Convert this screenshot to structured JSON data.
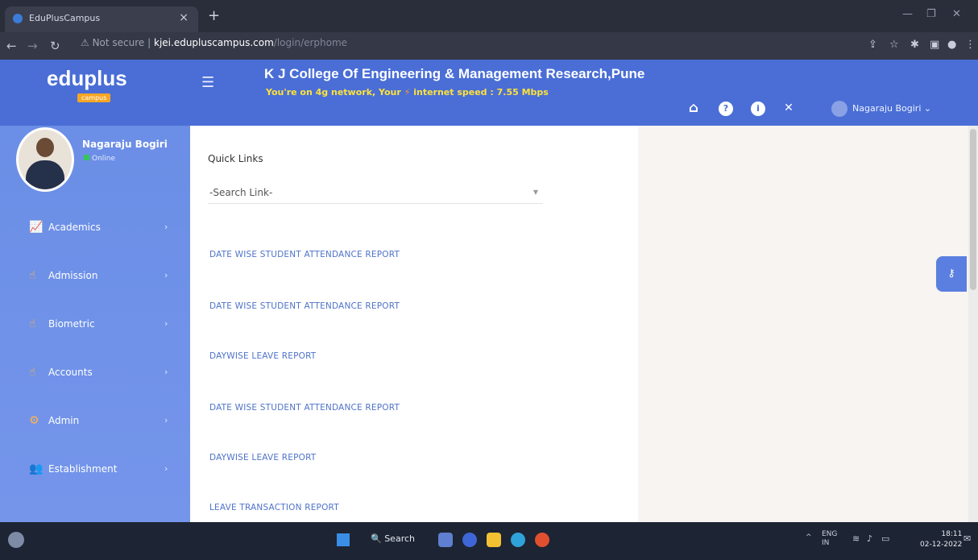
{
  "browser": {
    "tab_title": "EduPlusCampus",
    "tab_close": "×",
    "new_tab": "+",
    "not_secure": "Not secure",
    "url_host": "kjei.edupluscampus.com",
    "url_path": "/login/erphome"
  },
  "header": {
    "logo": "eduplus",
    "logo_sub": "campus",
    "college_name": "K J College Of Engineering & Management Research,Pune",
    "network_prefix": "You're on 4g network, Your",
    "network_suffix": "internet speed : 7.55 Mbps",
    "user_name": "Nagaraju Bogiri"
  },
  "sidebar": {
    "profile_name": "Nagaraju Bogiri",
    "status": "Online",
    "items": [
      {
        "label": "Academics"
      },
      {
        "label": "Admission"
      },
      {
        "label": "Biometric"
      },
      {
        "label": "Accounts"
      },
      {
        "label": "Admin"
      },
      {
        "label": "Establishment"
      }
    ]
  },
  "main": {
    "quick_links_title": "Quick Links",
    "search_placeholder": "-Search Link-",
    "links": [
      "DATE WISE STUDENT ATTENDANCE REPORT",
      "DATE WISE STUDENT ATTENDANCE REPORT",
      "DAYWISE LEAVE REPORT",
      "DATE WISE STUDENT ATTENDANCE REPORT",
      "DAYWISE LEAVE REPORT",
      "LEAVE TRANSACTION REPORT"
    ]
  },
  "taskbar": {
    "search_label": "Search",
    "lang_top": "ENG",
    "lang_bottom": "IN",
    "time": "18:11",
    "date": "02-12-2022"
  }
}
